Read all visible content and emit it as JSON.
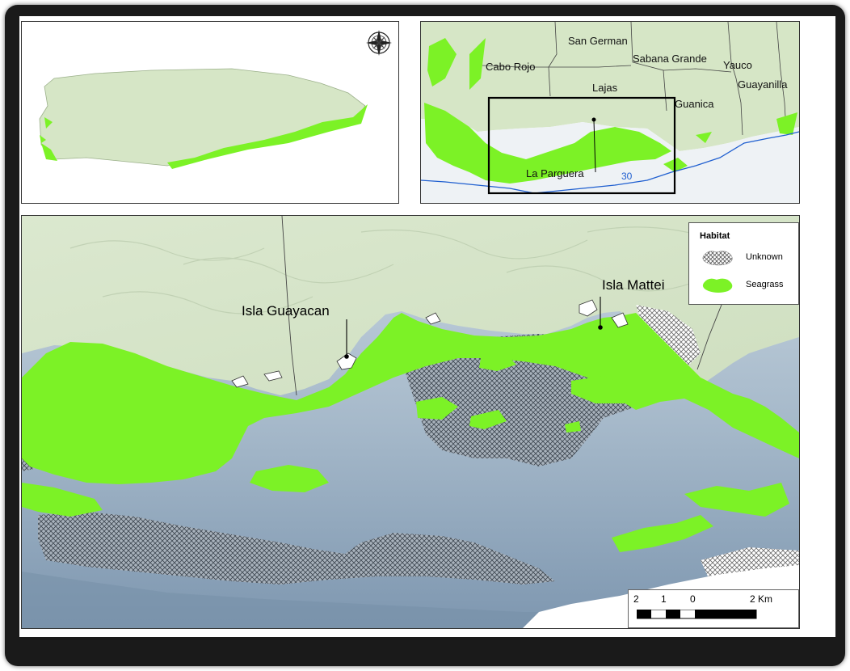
{
  "overview_map": {
    "north_arrow": "compass-rose-icon"
  },
  "locator_map": {
    "towns": {
      "san_german": "San German",
      "cabo_rojo": "Cabo Rojo",
      "sabana_grande": "Sabana Grande",
      "yauco": "Yauco",
      "guayanilla": "Guayanilla",
      "lajas": "Lajas",
      "guanica": "Guanica",
      "la_parguera": "La Parguera"
    },
    "depth_contour_label": "30"
  },
  "main_map": {
    "callouts": {
      "isla_guayacan": "Isla Guayacan",
      "isla_mattei": "Isla Mattei"
    },
    "legend": {
      "title": "Habitat",
      "items": [
        {
          "label": "Unknown",
          "pattern": "crosshatch"
        },
        {
          "label": "Seagrass",
          "color": "#7cf226"
        }
      ]
    },
    "scale_bar": {
      "ticks": [
        "2",
        "1",
        "0",
        "2 Km"
      ]
    }
  },
  "colors": {
    "land": "#d6e6c6",
    "seagrass": "#7cf226",
    "deep_water": "#8ca4bd",
    "shallow_water": "#c9d6e0",
    "contour": "#1f5fd0"
  }
}
